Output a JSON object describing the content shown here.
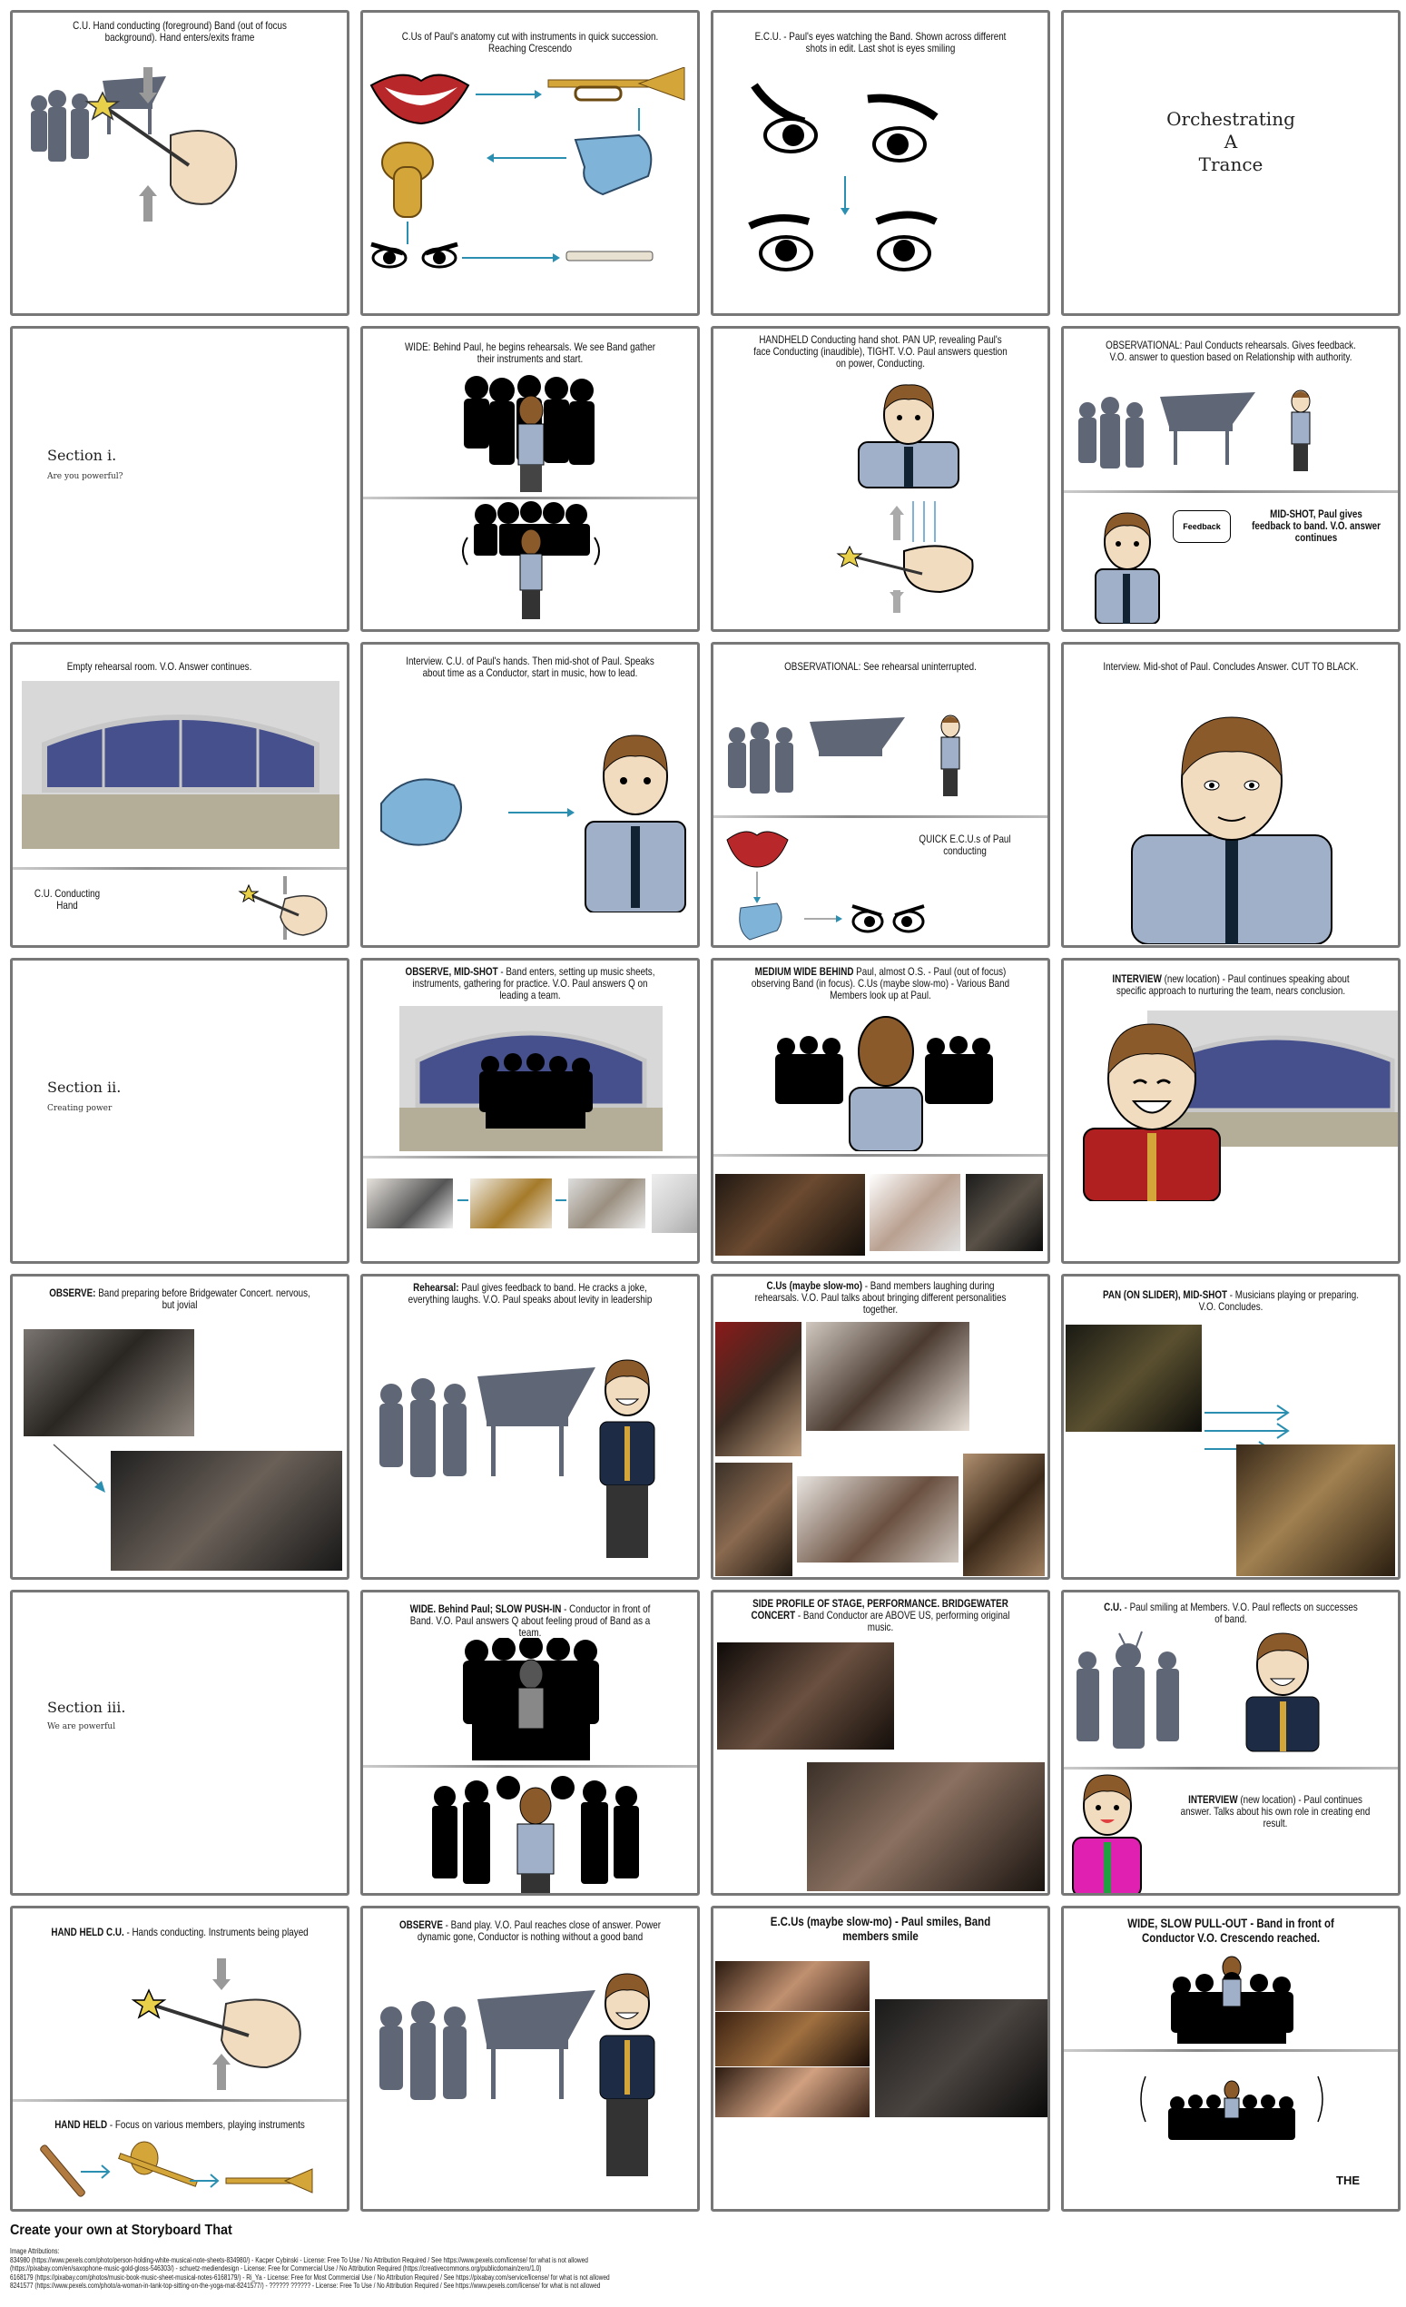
{
  "storyboard": {
    "cells": [
      {
        "id": 1,
        "caption": "C.U. Hand conducting (foreground) Band (out of focus background). Hand enters/exits frame"
      },
      {
        "id": 2,
        "caption": "C.Us of Paul's anatomy cut with instruments in quick succession. Reaching Crescendo"
      },
      {
        "id": 3,
        "caption": "E.C.U. - Paul's eyes watching the Band. Shown across different shots in edit. Last shot is eyes smiling"
      },
      {
        "id": 4,
        "title_lines": [
          "Orchestrating",
          "A",
          "Trance"
        ]
      },
      {
        "id": 5,
        "section_title": "Section i.",
        "section_subtitle": "Are you powerful?"
      },
      {
        "id": 6,
        "caption": "WIDE: Behind Paul, he begins rehearsals. We see Band gather their instruments and start."
      },
      {
        "id": 7,
        "caption": "HANDHELD Conducting hand shot. PAN UP, revealing Paul's face Conducting (inaudible), TIGHT. V.O. Paul answers question on power, Conducting."
      },
      {
        "id": 8,
        "caption": "OBSERVATIONAL: Paul Conducts rehearsals. Gives feedback. V.O. answer to question based on Relationship with authority.",
        "sub_caption": "MID-SHOT, Paul gives feedback to band. V.O. answer continues",
        "speech_bubble": "Feedback"
      },
      {
        "id": 9,
        "caption": "Empty rehearsal room. V.O. Answer continues.",
        "sub_caption": "C.U. Conducting Hand"
      },
      {
        "id": 10,
        "caption": "Interview. C.U. of Paul's hands. Then mid-shot of Paul. Speaks about time as a Conductor, start in music, how to lead."
      },
      {
        "id": 11,
        "caption": "OBSERVATIONAL: See rehearsal uninterrupted.",
        "sub_caption": "QUICK E.C.U.s of Paul conducting"
      },
      {
        "id": 12,
        "caption": "Interview. Mid-shot of Paul. Concludes Answer. CUT TO BLACK."
      },
      {
        "id": 13,
        "section_title": "Section ii.",
        "section_subtitle": "Creating power"
      },
      {
        "id": 14,
        "caption_bold": "OBSERVE, MID-SHOT",
        "caption": " - Band enters, setting up music sheets, instruments, gathering for practice. V.O. Paul answers Q on leading a team."
      },
      {
        "id": 15,
        "caption_bold": "MEDIUM WIDE BEHIND",
        "caption": " Paul, almost O.S. - Paul (out of focus) observing Band (in focus). C.Us (maybe slow-mo) - Various Band Members look up at Paul."
      },
      {
        "id": 16,
        "caption_bold": "INTERVIEW",
        "caption": " (new location) - Paul continues speaking about specific approach to nurturing the team, nears conclusion."
      },
      {
        "id": 17,
        "caption_bold": "OBSERVE:",
        "caption": " Band preparing before Bridgewater Concert. nervous, but jovial"
      },
      {
        "id": 18,
        "caption_bold": "Rehearsal:",
        "caption": " Paul gives feedback to band. He cracks a joke, everything laughs. V.O. Paul speaks about levity in leadership"
      },
      {
        "id": 19,
        "caption_bold": "C.Us (maybe slow-mo)",
        "caption": " - Band members laughing during rehearsals. V.O. Paul talks about bringing different personalities together."
      },
      {
        "id": 20,
        "caption_bold": "PAN (ON SLIDER), MID-SHOT",
        "caption": " - Musicians playing or preparing. V.O. Concludes."
      },
      {
        "id": 21,
        "section_title": "Section iii.",
        "section_subtitle": "We are powerful"
      },
      {
        "id": 22,
        "caption_bold": "WIDE. Behind Paul; SLOW PUSH-IN",
        "caption": " - Conductor in front of Band. V.O. Paul answers Q about feeling proud of Band as a team."
      },
      {
        "id": 23,
        "caption_bold": "SIDE PROFILE OF STAGE, PERFORMANCE. BRIDGEWATER CONCERT",
        "caption": " - Band Conductor are ABOVE US, performing original music."
      },
      {
        "id": 24,
        "caption_bold": "C.U.",
        "caption": " - Paul smiling at Members. V.O. Paul reflects on successes of band.",
        "sub_caption_bold": "INTERVIEW",
        "sub_caption": " (new location) - Paul continues answer. Talks about his own role in creating end result."
      },
      {
        "id": 25,
        "caption_bold": "HAND HELD C.U.",
        "caption": " - Hands conducting. Instruments being played",
        "sub_caption_bold": "HAND HELD",
        "sub_caption": " - Focus on various members, playing instruments"
      },
      {
        "id": 26,
        "caption_bold": "OBSERVE",
        "caption": " - Band play. V.O. Paul reaches close of answer. Power dynamic gone, Conductor is nothing without a good band"
      },
      {
        "id": 27,
        "caption_bold": "E.C.Us (maybe slow-mo)",
        "caption": " - Paul smiles, Band members smile"
      },
      {
        "id": 28,
        "caption_bold": "WIDE, SLOW PULL-OUT",
        "caption": " - Band in front of Conductor V.O. Crescendo reached.",
        "end_text": "THE"
      }
    ]
  },
  "footer": {
    "cta": "Create your own at Storyboard That",
    "attributions_label": "Image Attributions:",
    "attributions": [
      "834980 (https://www.pexels.com/photo/person-holding-white-musical-note-sheets-834980/) - Kacper Cybinski - License: Free To Use / No Attribution Required / See https://www.pexels.com/license/ for what is not allowed",
      "(https://pixabay.com/en/saxophone-music-gold-gloss-546303/) - schuetz-mediendesign - License: Free for Commercial Use / No Attribution Required (https://creativecommons.org/publicdomain/zero/1.0)",
      "6168179 (https://pixabay.com/photos/music-book-music-sheet-musical-notes-6168179/) - Ri_Ya - License: Free for Most Commercial Use / No Attribution Required / See https://pixabay.com/service/license/ for what is not allowed",
      "8241577 (https://www.pexels.com/photo/a-woman-in-tank-top-sitting-on-the-yoga-mat-8241577/) - ?????? ?????? - License: Free To Use / No Attribution Required / See https://www.pexels.com/license/ for what is not allowed"
    ]
  },
  "colors": {
    "border": "#777777",
    "shirt_blue": "#9fb0c8",
    "silhouette_gray": "#5f6675",
    "arrow_teal": "#2a8fb0",
    "stage_blue": "#45508c",
    "hand_blue": "#7fb3d8",
    "skin": "#f2dcc0",
    "hair": "#8a5a2b",
    "lips": "#b8282a",
    "brass": "#d4a63a",
    "pink_shirt": "#e020b0"
  }
}
